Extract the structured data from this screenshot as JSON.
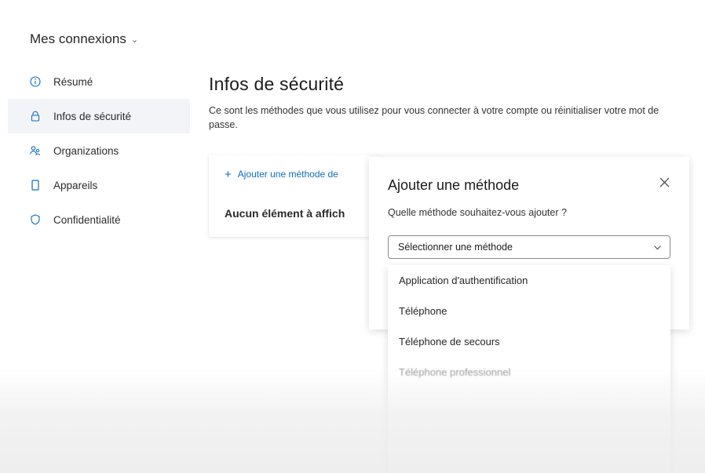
{
  "header": {
    "title": "Mes connexions"
  },
  "sidebar": {
    "items": [
      {
        "label": "Résumé",
        "icon": "info-icon"
      },
      {
        "label": "Infos de sécurité",
        "icon": "lock-icon",
        "active": true
      },
      {
        "label": "Organizations",
        "icon": "people-icon"
      },
      {
        "label": "Appareils",
        "icon": "device-icon"
      },
      {
        "label": "Confidentialité",
        "icon": "shield-icon"
      }
    ]
  },
  "main": {
    "title": "Infos de sécurité",
    "description": "Ce sont les méthodes que vous utilisez pour vous connecter à votre compte ou réinitialiser votre mot de passe.",
    "add_method_label": "Ajouter une méthode de",
    "empty_text": "Aucun élément à affich"
  },
  "dialog": {
    "title": "Ajouter une méthode",
    "question": "Quelle méthode souhaitez-vous ajouter ?",
    "select_value": "Sélectionner une méthode",
    "options": [
      "Application d'authentification",
      "Téléphone",
      "Téléphone de secours",
      "Téléphone professionnel"
    ]
  },
  "colors": {
    "accent": "#0f6cbd",
    "nav_active_bg": "#f3f4f8"
  }
}
